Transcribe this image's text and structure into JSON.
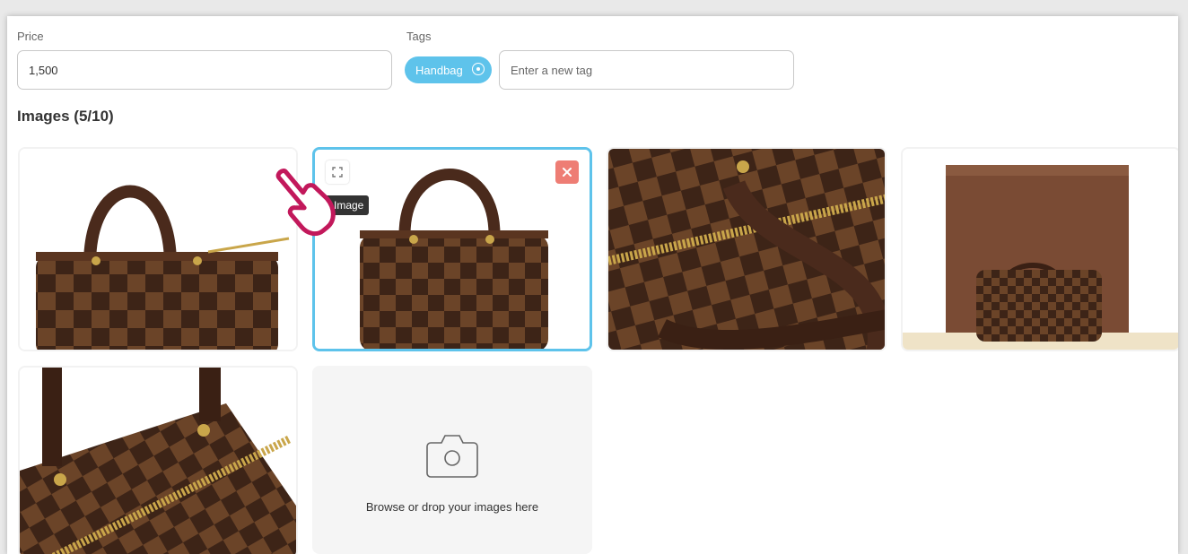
{
  "form": {
    "price_label": "Price",
    "price_value": "1,500",
    "tags_label": "Tags",
    "tags": [
      "Handbag"
    ],
    "new_tag_placeholder": "Enter a new tag"
  },
  "images": {
    "title": "Images (5/10)",
    "tooltip": "Image",
    "dropzone_text": "Browse or drop your images here"
  },
  "colors": {
    "accent": "#5ec3eb",
    "remove": "#ee7d74",
    "cursor": "#c2185b"
  },
  "icons": {
    "expand": "expand-arrows-icon",
    "remove": "close-icon",
    "camera": "camera-icon",
    "tag_remove": "circle-x-icon"
  }
}
